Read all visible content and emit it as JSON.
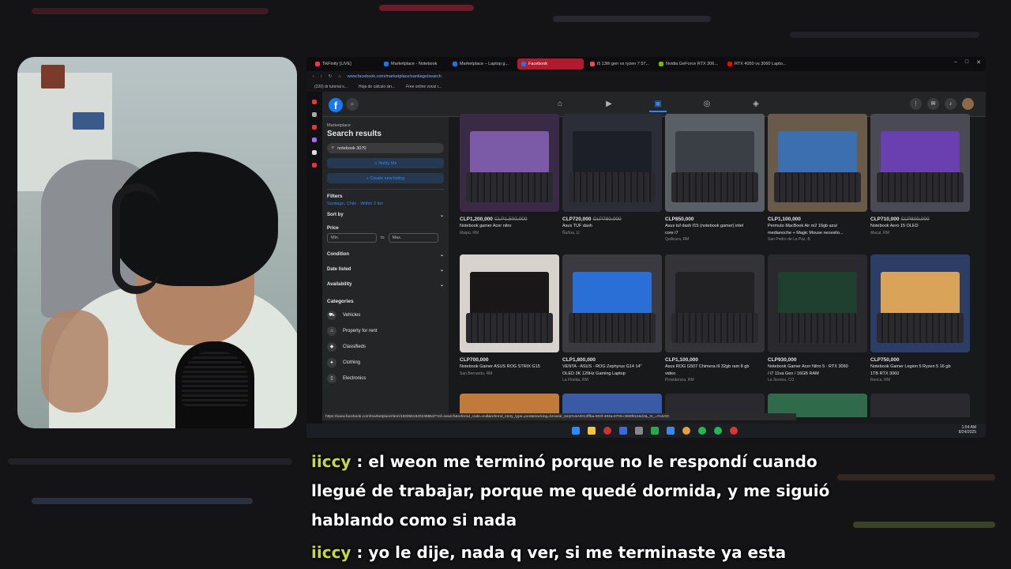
{
  "browser": {
    "tabs": [
      {
        "label": "TikFinity [LIVE]",
        "color": "#ff2d55",
        "active": false
      },
      {
        "label": "Marketplace - Notebook",
        "color": "#1877f2",
        "active": false
      },
      {
        "label": "Marketplace – Laptop g...",
        "color": "#1877f2",
        "active": false
      },
      {
        "label": "Facebook",
        "color": "#1877f2",
        "active": true
      },
      {
        "label": "i5 13th gen vs ryzen 7 57...",
        "color": "#ff4444",
        "active": false
      },
      {
        "label": "Nvidia GeForce RTX 306...",
        "color": "#76b900",
        "active": false
      },
      {
        "label": "RTX 4050 vs 3060 Lapto...",
        "color": "#ff0000",
        "active": false
      }
    ],
    "url": "www.facebook.com/marketplace/santiago/search",
    "bookmarks": [
      "(220) dr tutorial s...",
      "Hoja de cálculo sin...",
      "Free online vocal r..."
    ],
    "status_url": "https://www.facebook.com/marketplace/item/1833561820248853/?ref=search&referral_code=null&referral_story_type=post&tracking=browse_serp%3A0013ffba-083f-483a-8705-c068f8116d2&_tn_=!%3AD"
  },
  "sidebar": {
    "marketplace": "Marketplace",
    "title": "Search results",
    "search_value": "notebook 3070",
    "notify": "Notify Me",
    "create": "+ Create new listing",
    "filters": "Filters",
    "location": "Santiago, Chile · Within 2 km",
    "sort_by": "Sort by",
    "price": "Price",
    "min": "Min.",
    "to": "to",
    "max": "Max.",
    "condition": "Condition",
    "date_listed": "Date listed",
    "availability": "Availability",
    "categories": "Categories",
    "category_items": [
      {
        "label": "Vehicles",
        "icon": "car-icon"
      },
      {
        "label": "Property for rent",
        "icon": "home-icon"
      },
      {
        "label": "Classifieds",
        "icon": "tag-icon"
      },
      {
        "label": "Clothing",
        "icon": "shirt-icon"
      },
      {
        "label": "Electronics",
        "icon": "phone-icon"
      }
    ]
  },
  "listings": [
    {
      "price": "CLP1,200,000",
      "old": "CLP1,500,000",
      "title": "Notebook gamer Acer nitro",
      "title2": "",
      "location": "Maipú, RM",
      "bg": "#3a2a45",
      "screen": "#7b5ba8"
    },
    {
      "price": "CLP720,000",
      "old": "CLP780,000",
      "title": "Asus TUF dash",
      "title2": "",
      "location": "Ñuñoa, LI",
      "bg": "#2b2e36",
      "screen": "#1c1f27"
    },
    {
      "price": "CLP850,000",
      "old": "",
      "title": "Asus tuf dash f15 (notebook gamer) intel",
      "title2": "core i7",
      "location": "Quilicura, RM",
      "bg": "#5a5f66",
      "screen": "#3a3e45"
    },
    {
      "price": "CLP1,100,000",
      "old": "",
      "title": "Permuto MacBook Air m2 16gb azul",
      "title2": "medianoche + Magic Mouse necesito...",
      "location": "San Pedro de La Paz, B",
      "bg": "#6a5a4a",
      "screen": "#3b6fb0"
    },
    {
      "price": "CLP710,000",
      "old": "CLP800,000",
      "title": "Notebook Aero 15 OLED",
      "title2": "",
      "location": "Macul, RM",
      "bg": "#4a4a55",
      "screen": "#6a3fb0"
    },
    {
      "price": "CLP700,000",
      "old": "",
      "title": "Notebook Gamer ASUS ROG STRIX G15",
      "title2": "",
      "location": "San Bernardo, RM",
      "bg": "#d7d2cc",
      "screen": "#1a1718"
    },
    {
      "price": "CLP1,800,000",
      "old": "",
      "title": "VENTA - ASUS - ROG Zephyrus G14 14\"",
      "title2": "OLED 3K 120Hz Gaming Laptop",
      "location": "La Florida, RM",
      "bg": "#3a3a40",
      "screen": "#2a6fd6"
    },
    {
      "price": "CLP1,100,000",
      "old": "",
      "title": "Asus ROG G507 Chimera i9 32gb ram 8 gb",
      "title2": "video",
      "location": "Providencia, RM",
      "bg": "#343438",
      "screen": "#222225"
    },
    {
      "price": "CLP930,000",
      "old": "",
      "title": "Notebook Gamer Acer Nitro 5 - RTX 3060",
      "title2": "/ i7 11va Gen / 16GB RAM",
      "location": "La Serena, CO",
      "bg": "#2a2a2e",
      "screen": "#1f3f2f"
    },
    {
      "price": "CLP750,000",
      "old": "",
      "title": "Notebook Gamer Legion 5 Ryzen 5 16 gb",
      "title2": "1TB RTX 3060",
      "location": "Renca, RM",
      "bg": "#2c3e66",
      "screen": "#d9a45a"
    }
  ],
  "taskbar": {
    "time": "1:54 AM",
    "date": "8/24/2025"
  },
  "chat": [
    {
      "user": "iiccy",
      "sep": " : ",
      "text": "el weon me terminó porque no le respondí cuando"
    },
    {
      "user": "",
      "sep": "",
      "text": "llegué de trabajar, porque me quedé dormida, y me siguió"
    },
    {
      "user": "",
      "sep": "",
      "text": "hablando como si nada"
    },
    {
      "user": "iiccy",
      "sep": " : ",
      "text": "yo le dije, nada q ver, si me terminaste ya esta"
    }
  ],
  "colors": {
    "accent": "#2d88ff",
    "tab_active": "#b21a2d",
    "chat_user": "#c7d93b"
  }
}
